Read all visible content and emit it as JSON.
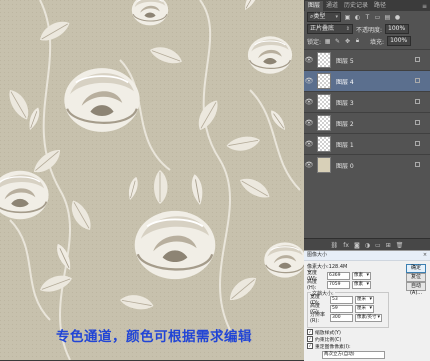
{
  "canvas": {
    "caption": "专色通道，颜色可根据需求编辑",
    "colors": {
      "background": "#c7c1ad",
      "flower": "#f1eee6",
      "shade": "#8d8474",
      "caption": "#2145d6"
    }
  },
  "panel": {
    "tabs": [
      "图层",
      "通道",
      "历史记录",
      "路径"
    ],
    "active_tab": 0,
    "filter_label": "类型",
    "blend_mode": "正片叠底",
    "opacity_label": "不透明度:",
    "opacity_value": "100%",
    "lock_label": "锁定:",
    "fill_label": "填充:",
    "fill_value": "100%",
    "layers": [
      {
        "name": "图层 5",
        "selected": false,
        "solid": false
      },
      {
        "name": "图层 4",
        "selected": true,
        "solid": false
      },
      {
        "name": "图层 3",
        "selected": false,
        "solid": false
      },
      {
        "name": "图层 2",
        "selected": false,
        "solid": false
      },
      {
        "name": "图层 1",
        "selected": false,
        "solid": false
      },
      {
        "name": "图层 0",
        "selected": false,
        "solid": true
      }
    ],
    "bottom_icons": [
      "link-icon",
      "fx-icon",
      "mask-icon",
      "adjustment-icon",
      "folder-icon",
      "new-layer-icon",
      "trash-icon"
    ]
  },
  "dialog": {
    "title": "图像大小",
    "pixel_dims": "像素大小:128.4M",
    "width_label": "宽度(W):",
    "width_value": "6369",
    "height_label": "高度(H):",
    "height_value": "7059",
    "pixel_unit": "像素",
    "doc_size_label": "文档大小:",
    "doc_width_label": "宽度(D):",
    "doc_width_value": "53",
    "doc_height_label": "高度(G):",
    "doc_height_value": "59",
    "doc_unit": "厘米",
    "resolution_label": "分辨率(R):",
    "resolution_value": "300",
    "resolution_unit": "像素/英寸",
    "ok_label": "确定",
    "cancel_label": "复位",
    "auto_label": "自动(A)...",
    "scale_styles": "缩放样式(Y)",
    "constrain": "约束比例(C)",
    "resample": "重定图像像素(I):",
    "resample_method": "两次立方(自动)"
  }
}
